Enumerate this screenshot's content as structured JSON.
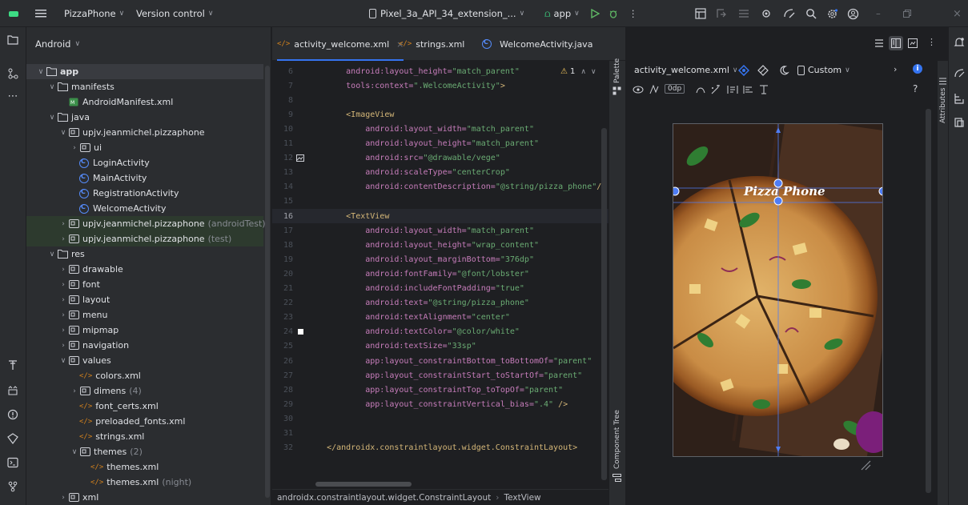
{
  "titlebar": {
    "project": "PizzaPhone",
    "vcs": "Version control",
    "device": "Pixel_3a_API_34_extension_...",
    "run_config": "app"
  },
  "project_panel": {
    "view": "Android",
    "tree": [
      {
        "label": "app",
        "arrow": "open",
        "indent": 0,
        "icon": "module",
        "selected": true
      },
      {
        "label": "manifests",
        "arrow": "open",
        "indent": 1,
        "icon": "folder"
      },
      {
        "label": "AndroidManifest.xml",
        "arrow": "",
        "indent": 2,
        "icon": "manifest"
      },
      {
        "label": "java",
        "arrow": "open",
        "indent": 1,
        "icon": "folder"
      },
      {
        "label": "upjv.jeanmichel.pizzaphone",
        "arrow": "open",
        "indent": 2,
        "icon": "package"
      },
      {
        "label": "ui",
        "arrow": "closed",
        "indent": 3,
        "icon": "package"
      },
      {
        "label": "LoginActivity",
        "arrow": "",
        "indent": 3,
        "icon": "class"
      },
      {
        "label": "MainActivity",
        "arrow": "",
        "indent": 3,
        "icon": "class"
      },
      {
        "label": "RegistrationActivity",
        "arrow": "",
        "indent": 3,
        "icon": "class"
      },
      {
        "label": "WelcomeActivity",
        "arrow": "",
        "indent": 3,
        "icon": "class"
      },
      {
        "label": "upjv.jeanmichel.pizzaphone",
        "suffix": "(androidTest)",
        "arrow": "closed",
        "indent": 2,
        "icon": "package",
        "green": true
      },
      {
        "label": "upjv.jeanmichel.pizzaphone",
        "suffix": "(test)",
        "arrow": "closed",
        "indent": 2,
        "icon": "package",
        "green": true
      },
      {
        "label": "res",
        "arrow": "open",
        "indent": 1,
        "icon": "res"
      },
      {
        "label": "drawable",
        "arrow": "closed",
        "indent": 2,
        "icon": "package"
      },
      {
        "label": "font",
        "arrow": "closed",
        "indent": 2,
        "icon": "package"
      },
      {
        "label": "layout",
        "arrow": "closed",
        "indent": 2,
        "icon": "package"
      },
      {
        "label": "menu",
        "arrow": "closed",
        "indent": 2,
        "icon": "package"
      },
      {
        "label": "mipmap",
        "arrow": "closed",
        "indent": 2,
        "icon": "package"
      },
      {
        "label": "navigation",
        "arrow": "closed",
        "indent": 2,
        "icon": "package"
      },
      {
        "label": "values",
        "arrow": "open",
        "indent": 2,
        "icon": "package"
      },
      {
        "label": "colors.xml",
        "arrow": "",
        "indent": 3,
        "icon": "xml"
      },
      {
        "label": "dimens",
        "suffix": "(4)",
        "arrow": "closed",
        "indent": 3,
        "icon": "package"
      },
      {
        "label": "font_certs.xml",
        "arrow": "",
        "indent": 3,
        "icon": "xml"
      },
      {
        "label": "preloaded_fonts.xml",
        "arrow": "",
        "indent": 3,
        "icon": "xml"
      },
      {
        "label": "strings.xml",
        "arrow": "",
        "indent": 3,
        "icon": "xml"
      },
      {
        "label": "themes",
        "suffix": "(2)",
        "arrow": "open",
        "indent": 3,
        "icon": "package"
      },
      {
        "label": "themes.xml",
        "arrow": "",
        "indent": 4,
        "icon": "xml"
      },
      {
        "label": "themes.xml",
        "suffix": "(night)",
        "arrow": "",
        "indent": 4,
        "icon": "xml"
      },
      {
        "label": "xml",
        "arrow": "closed",
        "indent": 2,
        "icon": "package"
      }
    ]
  },
  "tabs": [
    {
      "label": "activity_welcome.xml",
      "active": true,
      "closable": true
    },
    {
      "label": "strings.xml",
      "active": false
    },
    {
      "label": "WelcomeActivity.java",
      "active": false
    }
  ],
  "editor": {
    "warning_count": "1",
    "current_line": 16,
    "lines": [
      {
        "n": "6",
        "parts": [
          [
            "attr",
            "        android:layout_height="
          ],
          [
            "val",
            "\"match_parent\""
          ]
        ]
      },
      {
        "n": "7",
        "parts": [
          [
            "attr",
            "        tools:context="
          ],
          [
            "val",
            "\".WelcomeActivity\""
          ],
          [
            "tag",
            ">"
          ]
        ]
      },
      {
        "n": "8",
        "parts": []
      },
      {
        "n": "9",
        "parts": [
          [
            "tag",
            "        <ImageView"
          ]
        ]
      },
      {
        "n": "10",
        "parts": [
          [
            "attr",
            "            android:layout_width="
          ],
          [
            "val",
            "\"match_parent\""
          ]
        ]
      },
      {
        "n": "11",
        "parts": [
          [
            "attr",
            "            android:layout_height="
          ],
          [
            "val",
            "\"match_parent\""
          ]
        ]
      },
      {
        "n": "12",
        "gutter": "image",
        "parts": [
          [
            "attr",
            "            android:src="
          ],
          [
            "val",
            "\"@drawable/vege\""
          ]
        ]
      },
      {
        "n": "13",
        "parts": [
          [
            "attr",
            "            android:scaleType="
          ],
          [
            "val",
            "\"centerCrop\""
          ]
        ]
      },
      {
        "n": "14",
        "parts": [
          [
            "attr",
            "            android:contentDescription="
          ],
          [
            "val",
            "\"@string/pizza_phone\""
          ],
          [
            "tag",
            "/>"
          ]
        ]
      },
      {
        "n": "15",
        "parts": []
      },
      {
        "n": "16",
        "parts": [
          [
            "tag",
            "        <TextView"
          ]
        ]
      },
      {
        "n": "17",
        "parts": [
          [
            "attr",
            "            android:layout_width="
          ],
          [
            "val",
            "\"match_parent\""
          ]
        ]
      },
      {
        "n": "18",
        "parts": [
          [
            "attr",
            "            android:layout_height="
          ],
          [
            "val",
            "\"wrap_content\""
          ]
        ]
      },
      {
        "n": "19",
        "parts": [
          [
            "attr",
            "            android:layout_marginBottom="
          ],
          [
            "val",
            "\"376dp\""
          ]
        ]
      },
      {
        "n": "20",
        "parts": [
          [
            "attr",
            "            android:fontFamily="
          ],
          [
            "val",
            "\"@font/lobster\""
          ]
        ]
      },
      {
        "n": "21",
        "parts": [
          [
            "attr",
            "            android:includeFontPadding="
          ],
          [
            "val",
            "\"true\""
          ]
        ]
      },
      {
        "n": "22",
        "parts": [
          [
            "attr",
            "            android:text="
          ],
          [
            "val",
            "\"@string/pizza_phone\""
          ]
        ]
      },
      {
        "n": "23",
        "parts": [
          [
            "attr",
            "            android:textAlignment="
          ],
          [
            "val",
            "\"center\""
          ]
        ]
      },
      {
        "n": "24",
        "gutter": "white",
        "parts": [
          [
            "attr",
            "            android:textColor="
          ],
          [
            "val",
            "\"@color/white\""
          ]
        ]
      },
      {
        "n": "25",
        "parts": [
          [
            "attr",
            "            android:textSize="
          ],
          [
            "val",
            "\"33sp\""
          ]
        ]
      },
      {
        "n": "26",
        "parts": [
          [
            "attr",
            "            app:layout_constraintBottom_toBottomOf="
          ],
          [
            "val",
            "\"parent\""
          ]
        ]
      },
      {
        "n": "27",
        "parts": [
          [
            "attr",
            "            app:layout_constraintStart_toStartOf="
          ],
          [
            "val",
            "\"parent\""
          ]
        ]
      },
      {
        "n": "28",
        "parts": [
          [
            "attr",
            "            app:layout_constraintTop_toTopOf="
          ],
          [
            "val",
            "\"parent\""
          ]
        ]
      },
      {
        "n": "29",
        "parts": [
          [
            "attr",
            "            app:layout_constraintVertical_bias="
          ],
          [
            "val",
            "\".4\" "
          ],
          [
            "tag",
            "/>"
          ]
        ]
      },
      {
        "n": "30",
        "parts": []
      },
      {
        "n": "31",
        "parts": []
      },
      {
        "n": "32",
        "parts": [
          [
            "tag",
            "    </androidx.constraintlayout.widget.ConstraintLayout>"
          ]
        ]
      }
    ]
  },
  "breadcrumb": [
    "androidx.constraintlayout.widget.ConstraintLayout",
    "TextView"
  ],
  "side_labels": {
    "palette": "Palette",
    "component_tree": "Component Tree",
    "attributes": "Attributes"
  },
  "design": {
    "file": "activity_welcome.xml",
    "device": "Custom",
    "margin": "0dp",
    "preview_text": "Pizza Phone",
    "help": "?"
  },
  "colors": {
    "accent": "#3574f0",
    "attr": "#c77dbb",
    "value": "#6aab73",
    "tag": "#d5b778"
  }
}
